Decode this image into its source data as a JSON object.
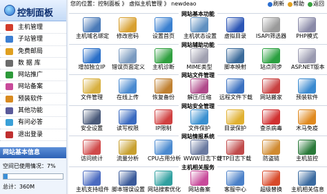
{
  "sidebar": {
    "title": "控制面板",
    "items": [
      {
        "label": "主机管理",
        "icon": "host-icon",
        "color": "#d23c2c"
      },
      {
        "label": "子站管理",
        "icon": "site-icon",
        "color": "#3c7fd2"
      },
      {
        "label": "免费邮局",
        "icon": "mail-icon",
        "color": "#e0a020"
      },
      {
        "label": "数 据 库",
        "icon": "database-icon",
        "color": "#6b6b6b"
      },
      {
        "label": "网站推广",
        "icon": "promote-icon",
        "color": "#2e9a3a"
      },
      {
        "label": "网站备案",
        "icon": "record-icon",
        "color": "#c84a9a"
      },
      {
        "label": "预装软件",
        "icon": "software-icon",
        "color": "#d88a20"
      },
      {
        "label": "其他功能",
        "icon": "tools-icon",
        "color": "#5a5a9a"
      },
      {
        "label": "有问必答",
        "icon": "help-icon",
        "color": "#3aa0d8"
      },
      {
        "label": "退出登录",
        "icon": "logout-icon",
        "color": "#c03030"
      }
    ],
    "info_title": "网站基本信息",
    "space_label": "空间已使用情况：7%",
    "space_percent": 7,
    "total_label": "总计：360M"
  },
  "topbar": {
    "breadcrumb": "您的位置：控制面板 》 虚拟主机管理 》 newdeao",
    "refresh": "刷新",
    "help": "帮助",
    "back": "返回"
  },
  "sections": [
    {
      "title": "网站基本功能",
      "items": [
        {
          "label": "主机域名绑定",
          "icon": "domain-bind-icon",
          "color": "#4a7ab8"
        },
        {
          "label": "修改密码",
          "icon": "password-icon",
          "color": "#d8a030"
        },
        {
          "label": "设置首页",
          "icon": "homepage-icon",
          "color": "#3a80d0"
        },
        {
          "label": "主机状态设置",
          "icon": "status-icon",
          "color": "#6090c0"
        },
        {
          "label": "虚拟目录",
          "icon": "vdir-icon",
          "color": "#2b55b5"
        },
        {
          "label": "ISAPI筛选器",
          "icon": "isapi-icon",
          "color": "#9a9a9a"
        },
        {
          "label": "PHP模式",
          "icon": "php-icon",
          "color": "#8a8aa8"
        }
      ]
    },
    {
      "title": "网站辅助功能",
      "items": [
        {
          "label": "增加独立IP",
          "icon": "ip-icon",
          "color": "#2a6fc8"
        },
        {
          "label": "错误页面定义",
          "icon": "error-page-icon",
          "color": "#7a9ac0"
        },
        {
          "label": "主机诊断",
          "icon": "diagnose-icon",
          "color": "#30a040"
        },
        {
          "label": "MIME类型",
          "icon": "mime-icon",
          "color": "#a0a0b0"
        },
        {
          "label": "脚本映射",
          "icon": "script-map-icon",
          "color": "#3a6a9a"
        },
        {
          "label": "站点同步",
          "icon": "sync-icon",
          "color": "#2aa040"
        },
        {
          "label": "ASP.NET版本",
          "icon": "aspnet-icon",
          "color": "#9a9ab0"
        }
      ]
    },
    {
      "title": "网站文件管理",
      "items": [
        {
          "label": "文件管理",
          "icon": "file-manage-icon",
          "color": "#d8b040"
        },
        {
          "label": "在线上传",
          "icon": "upload-icon",
          "color": "#4a8ad0"
        },
        {
          "label": "恢复备份",
          "icon": "restore-icon",
          "color": "#c08030"
        },
        {
          "label": "解压/压缩",
          "icon": "zip-icon",
          "color": "#b04a8a"
        },
        {
          "label": "远程文件下载",
          "icon": "remote-download-icon",
          "color": "#3a70c0"
        },
        {
          "label": "网站搬家",
          "icon": "move-icon",
          "color": "#c84040"
        },
        {
          "label": "预装软件",
          "icon": "preinstall-icon",
          "color": "#3a8ad0"
        }
      ]
    },
    {
      "title": "网站安全管理",
      "items": [
        {
          "label": "安全设置",
          "icon": "security-icon",
          "color": "#4a5a7a"
        },
        {
          "label": "读写权限",
          "icon": "permission-icon",
          "color": "#3a6ac0"
        },
        {
          "label": "IP限制",
          "icon": "ip-limit-icon",
          "color": "#d04040"
        },
        {
          "label": "文件保护",
          "icon": "file-protect-icon",
          "color": "#3a90d0"
        },
        {
          "label": "目录保护",
          "icon": "dir-protect-icon",
          "color": "#e0b030"
        },
        {
          "label": "查杀病毒",
          "icon": "antivirus-icon",
          "color": "#d03030"
        },
        {
          "label": "木马免疫",
          "icon": "trojan-icon",
          "color": "#e08a20"
        }
      ]
    },
    {
      "title": "网站情报系统",
      "items": [
        {
          "label": "访问统计",
          "icon": "stats-icon",
          "color": "#d04a4a"
        },
        {
          "label": "流量分析",
          "icon": "traffic-icon",
          "color": "#c8a030"
        },
        {
          "label": "CPU占用分析",
          "icon": "cpu-icon",
          "color": "#4a8ad0"
        },
        {
          "label": "WWW日志下载",
          "icon": "www-log-icon",
          "color": "#6a7aa0"
        },
        {
          "label": "FTP日志下载",
          "icon": "ftp-log-icon",
          "color": "#c04a4a"
        },
        {
          "label": "防盗链",
          "icon": "hotlink-icon",
          "color": "#d08a30"
        },
        {
          "label": "主机监控",
          "icon": "monitor-icon",
          "color": "#2a7a3a"
        }
      ]
    },
    {
      "title": "主机相关服务",
      "items": [
        {
          "label": "主机支持组件",
          "icon": "components-icon",
          "color": "#4a6ac0"
        },
        {
          "label": "脚本错误设置",
          "icon": "script-error-icon",
          "color": "#3a5a9a"
        },
        {
          "label": "网站搜索优化",
          "icon": "seo-icon",
          "color": "#30a0a0"
        },
        {
          "label": "网站备案",
          "icon": "record-service-icon",
          "color": "#c84a9a"
        },
        {
          "label": "客服中心",
          "icon": "service-center-icon",
          "color": "#4a80c8"
        },
        {
          "label": "超级替换",
          "icon": "replace-icon",
          "color": "#d84a2a"
        },
        {
          "label": "主机相关信息",
          "icon": "host-info-icon",
          "color": "#3a6aa0"
        }
      ]
    }
  ]
}
